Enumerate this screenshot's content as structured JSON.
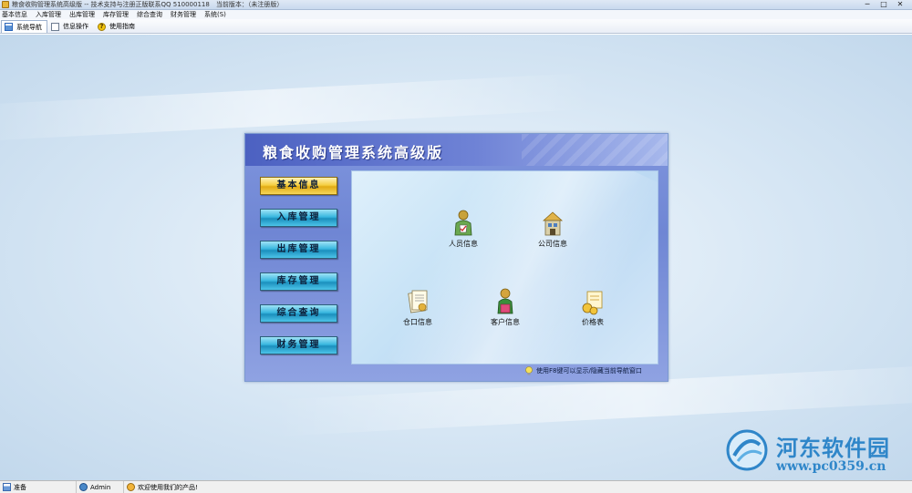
{
  "window": {
    "title": "粮食收购管理系统高级版 -- 技术支持与注册正版联系QQ 510000118　当前版本：（未注册版）",
    "minimize": "─",
    "maximize": "□",
    "close": "✕"
  },
  "menu": [
    "基本信息",
    "入库管理",
    "出库管理",
    "库存管理",
    "综合查询",
    "财务管理",
    "系统(S)"
  ],
  "toolbar": {
    "tabs": [
      {
        "label": "系统导航",
        "icon": "navigation-window-icon",
        "active": true
      },
      {
        "label": "信息操作",
        "icon": "info-window-icon",
        "active": false
      },
      {
        "label": "使用指南",
        "icon": "help-icon",
        "active": false
      }
    ],
    "help_glyph": "?"
  },
  "panel": {
    "title": "粮食收购管理系统高级版",
    "buttons": [
      "基本信息",
      "入库管理",
      "出库管理",
      "库存管理",
      "综合查询",
      "财务管理"
    ],
    "active_button": 0,
    "tiles": [
      {
        "label": "人员信息",
        "icon": "person-icon"
      },
      {
        "label": "公司信息",
        "icon": "company-building-icon"
      },
      {
        "label": "仓口信息",
        "icon": "warehouse-document-icon"
      },
      {
        "label": "客户信息",
        "icon": "customer-icon"
      },
      {
        "label": "价格表",
        "icon": "price-table-icon"
      }
    ],
    "hint": "使用F8键可以显示/隐藏当前导航窗口"
  },
  "watermark": {
    "name": "河东软件园",
    "url": "www.pc0359.cn"
  },
  "status": {
    "ready": "准备",
    "user": "Admin",
    "message": "欢迎使用我们的产品!"
  },
  "colors": {
    "accent": "#2f86c9",
    "button_blue": "#38b7df",
    "button_active": "#f5cf42",
    "panel_header": "#4c61c1"
  }
}
